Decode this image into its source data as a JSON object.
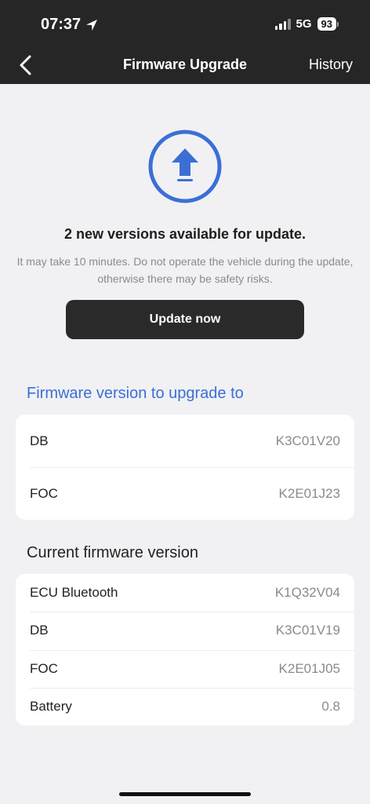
{
  "status_bar": {
    "time": "07:37",
    "network": "5G",
    "battery": "93"
  },
  "nav": {
    "title": "Firmware Upgrade",
    "history": "History"
  },
  "upgrade": {
    "headline": "2 new versions available for update.",
    "description": "It may take 10 minutes. Do not operate the vehicle during the update, otherwise there may be safety risks.",
    "button": "Update now",
    "icon_color": "#3b6fd6"
  },
  "target_section": {
    "title": "Firmware version to upgrade to",
    "rows": [
      {
        "label": "DB",
        "value": "K3C01V20"
      },
      {
        "label": "FOC",
        "value": "K2E01J23"
      }
    ]
  },
  "current_section": {
    "title": "Current firmware version",
    "rows": [
      {
        "label": "ECU Bluetooth",
        "value": "K1Q32V04"
      },
      {
        "label": "DB",
        "value": "K3C01V19"
      },
      {
        "label": "FOC",
        "value": "K2E01J05"
      },
      {
        "label": "Battery",
        "value": "0.8"
      }
    ]
  }
}
